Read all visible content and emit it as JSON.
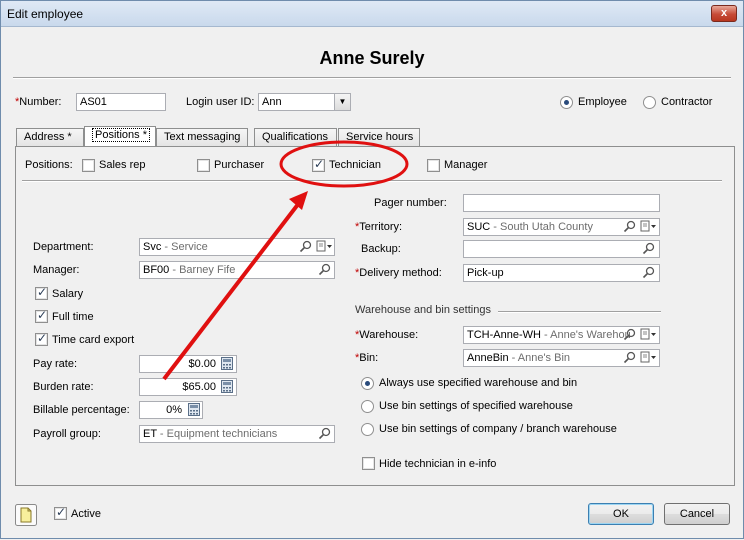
{
  "window": {
    "title": "Edit employee",
    "close_glyph": "x"
  },
  "employee": {
    "name": "Anne Surely"
  },
  "header": {
    "number_label": "Number:",
    "number_value": "AS01",
    "login_label": "Login user ID:",
    "login_value": "Ann",
    "type_employee": "Employee",
    "type_contractor": "Contractor"
  },
  "tabs": [
    {
      "label": "Address *"
    },
    {
      "label": "Positions *"
    },
    {
      "label": "Text messaging"
    },
    {
      "label": "Qualifications"
    },
    {
      "label": "Service hours"
    }
  ],
  "positions": {
    "label": "Positions:",
    "sales_rep": "Sales rep",
    "purchaser": "Purchaser",
    "technician": "Technician",
    "manager": "Manager"
  },
  "left": {
    "department_label": "Department:",
    "department_code": "Svc",
    "department_desc": " - Service",
    "manager_label": "Manager:",
    "manager_code": "BF00",
    "manager_desc": " - Barney Fife",
    "salary": "Salary",
    "full_time": "Full time",
    "time_card_export": "Time card export",
    "pay_rate_label": "Pay rate:",
    "pay_rate_value": "$0.00",
    "burden_rate_label": "Burden rate:",
    "burden_rate_value": "$65.00",
    "billable_label": "Billable percentage:",
    "billable_value": "0%",
    "payroll_label": "Payroll group:",
    "payroll_code": "ET",
    "payroll_desc": " - Equipment technicians"
  },
  "right": {
    "pager_label": "Pager number:",
    "pager_value": "",
    "territory_label": "Territory:",
    "territory_code": "SUC",
    "territory_desc": " - South Utah County",
    "backup_label": "Backup:",
    "backup_value": "",
    "delivery_label": "Delivery method:",
    "delivery_value": "Pick-up",
    "warehouse_section": "Warehouse and bin settings",
    "warehouse_label": "Warehouse:",
    "warehouse_code": "TCH-Anne-WH",
    "warehouse_desc": " - Anne's Warehou",
    "bin_label": "Bin:",
    "bin_code": "AnneBin",
    "bin_desc": " - Anne's Bin",
    "opt_always": "Always use specified warehouse and bin",
    "opt_bin_specified": "Use bin settings of specified warehouse",
    "opt_bin_company": "Use bin settings of company / branch warehouse",
    "hide_tech": "Hide technician in e-info"
  },
  "footer": {
    "active": "Active",
    "ok": "OK",
    "cancel": "Cancel"
  },
  "colors": {
    "annotation": "#e01010",
    "required": "#c00000"
  }
}
